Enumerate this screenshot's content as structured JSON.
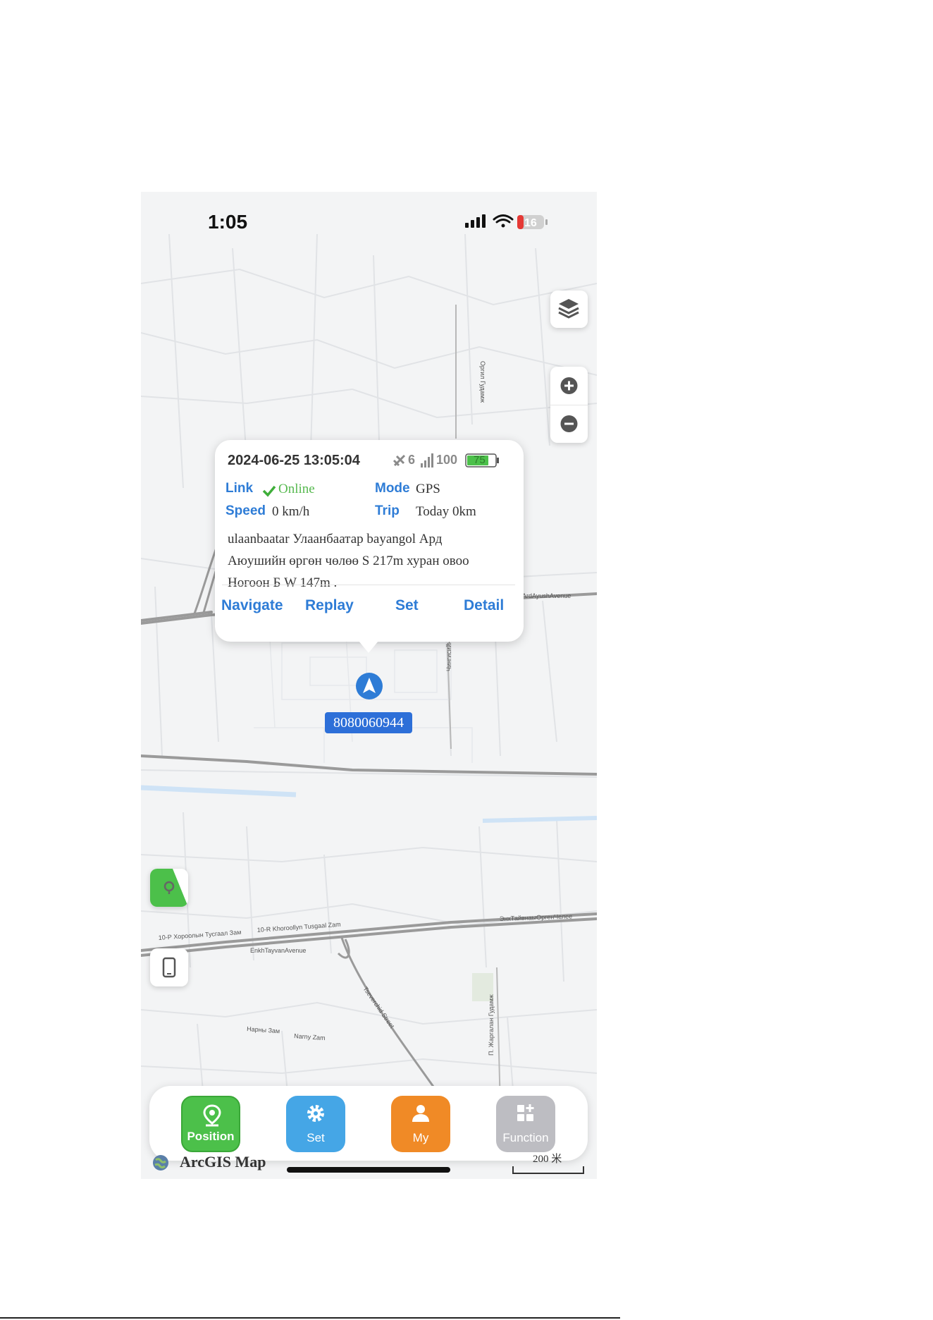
{
  "status_bar": {
    "time": "1:05",
    "battery": "16"
  },
  "popup": {
    "datetime": "2024-06-25 13:05:04",
    "satellites": "6",
    "signal": "100",
    "battery": "75",
    "link_label": "Link",
    "link_value": "Online",
    "mode_label": "Mode",
    "mode_value": "GPS",
    "speed_label": "Speed",
    "speed_value": "0 km/h",
    "trip_label": "Trip",
    "trip_value": "Today 0km",
    "address_line1": "ulaanbaatar Улаанбаатар bayangol Ард",
    "address_line2": "Аюушийн өргөн чөлөө S 217m хуран овоо",
    "address_line3": "Ногоон Б W 147m .",
    "actions": [
      "Navigate",
      "Replay",
      "Set",
      "Detail"
    ]
  },
  "device": {
    "id": "8080060944"
  },
  "map_labels": {
    "ard_ayush": "ArdAyushAvenue",
    "enkh_tayvan": "EnkhTayvanAvenue",
    "khoroolol": "10-R Khoroollyn Tusgaal Zam",
    "khoroolol_mn": "10-Р Хороолын Тусгаал Зам",
    "enkh_tayvan_mn": "ЭнхТайвнаыОргенЧелее",
    "narny": "Narny Zam",
    "narny_mn": "Нарны Зам",
    "tseverchid": "Tseverchid Street",
    "orgil": "Оргил Гудамж",
    "zhargalan": "П. Жаргалан Гудамж",
    "chinggis": "Чингисийн"
  },
  "tabbar": {
    "position": "Position",
    "set": "Set",
    "my": "My",
    "function": "Function"
  },
  "footer": {
    "provider": "ArcGIS Map",
    "scale": "200 米"
  },
  "colors": {
    "accent": "#2e7cd6",
    "green": "#4cc04a",
    "blue": "#45a6e6",
    "orange": "#f08a26",
    "gray": "#bdbdc2",
    "online": "#56b94f"
  },
  "icons": [
    "layers-icon",
    "zoom-in-icon",
    "zoom-out-icon",
    "navigation-arrow-icon",
    "satellite-icon",
    "signal-icon",
    "battery-icon",
    "check-icon",
    "location-pin-icon",
    "gear-icon",
    "person-icon",
    "grid-plus-icon",
    "phone-icon",
    "globe-icon"
  ]
}
